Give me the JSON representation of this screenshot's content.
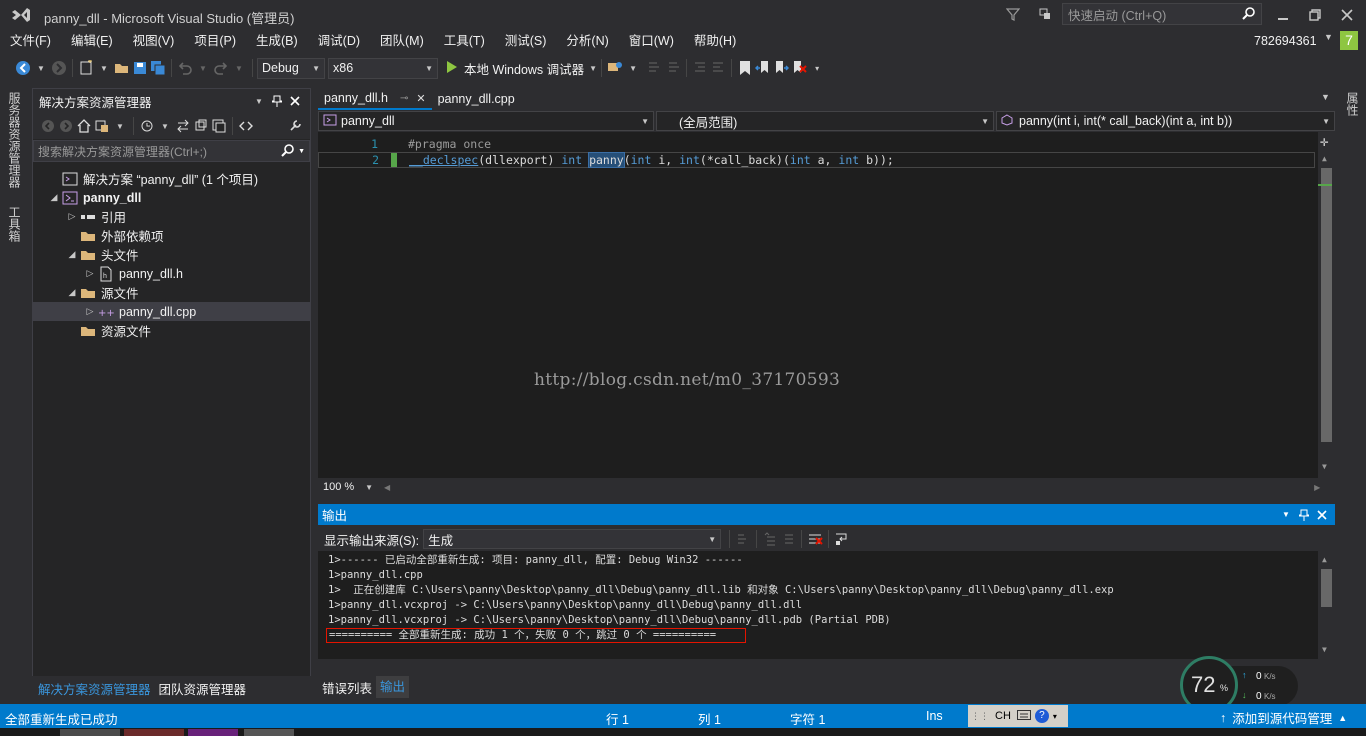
{
  "window": {
    "title": "panny_dll - Microsoft Visual Studio (管理员)",
    "quick_launch_placeholder": "快速启动 (Ctrl+Q)",
    "user": "782694361",
    "notif_count": "7"
  },
  "menu": [
    "文件(F)",
    "编辑(E)",
    "视图(V)",
    "项目(P)",
    "生成(B)",
    "调试(D)",
    "团队(M)",
    "工具(T)",
    "测试(S)",
    "分析(N)",
    "窗口(W)",
    "帮助(H)"
  ],
  "toolbar": {
    "config": "Debug",
    "platform": "x86",
    "run_label": "本地 Windows 调试器"
  },
  "left_strip": {
    "tab1": "服务器资源管理器",
    "tab2": "工具箱"
  },
  "right_strip": {
    "tab1": "属性"
  },
  "solution_explorer": {
    "title": "解决方案资源管理器",
    "search_placeholder": "搜索解决方案资源管理器(Ctrl+;)",
    "items": [
      {
        "label": "解决方案 “panny_dll” (1 个项目)",
        "indent": 0,
        "twisty": "",
        "icon": "solution-icon"
      },
      {
        "label": "panny_dll",
        "indent": 0,
        "twisty": "◢",
        "icon": "project-icon",
        "bold": true
      },
      {
        "label": "引用",
        "indent": 1,
        "twisty": "▷",
        "icon": "references-icon"
      },
      {
        "label": "外部依赖项",
        "indent": 1,
        "twisty": "",
        "icon": "folder-icon"
      },
      {
        "label": "头文件",
        "indent": 1,
        "twisty": "◢",
        "icon": "folder-icon"
      },
      {
        "label": "panny_dll.h",
        "indent": 2,
        "twisty": "▷",
        "icon": "header-file-icon"
      },
      {
        "label": "源文件",
        "indent": 1,
        "twisty": "◢",
        "icon": "folder-icon"
      },
      {
        "label": "panny_dll.cpp",
        "indent": 2,
        "twisty": "▷",
        "icon": "cpp-file-icon",
        "selected": true
      },
      {
        "label": "资源文件",
        "indent": 1,
        "twisty": "",
        "icon": "folder-icon"
      }
    ],
    "tabs": [
      "解决方案资源管理器",
      "团队资源管理器"
    ]
  },
  "editor": {
    "tabs": [
      "panny_dll.h",
      "panny_dll.cpp"
    ],
    "nav": {
      "project": "panny_dll",
      "scope": "(全局范围)",
      "member": "panny(int i, int(* call_back)(int a, int b))"
    },
    "line_numbers": [
      "1",
      "2"
    ],
    "line1": "#pragma once",
    "line2": {
      "a": "__declspec",
      "b": "(dllexport) ",
      "c": "int",
      "d": " ",
      "e": "panny",
      "f": "(",
      "g": "int",
      "h": " i, ",
      "i": "int",
      "j": "(*call_back)(",
      "k": "int",
      "l": " a, ",
      "m": "int",
      "n": " b));"
    },
    "watermark": "http://blog.csdn.net/m0_37170593",
    "zoom": "100 %"
  },
  "output": {
    "title": "输出",
    "source_label": "显示输出来源(S):",
    "source_value": "生成",
    "lines": [
      "1>------ 已启动全部重新生成: 项目: panny_dll, 配置: Debug Win32 ------",
      "1>panny_dll.cpp",
      "1>  正在创建库 C:\\Users\\panny\\Desktop\\panny_dll\\Debug\\panny_dll.lib 和对象 C:\\Users\\panny\\Desktop\\panny_dll\\Debug\\panny_dll.exp",
      "1>panny_dll.vcxproj -> C:\\Users\\panny\\Desktop\\panny_dll\\Debug\\panny_dll.dll",
      "1>panny_dll.vcxproj -> C:\\Users\\panny\\Desktop\\panny_dll\\Debug\\panny_dll.pdb (Partial PDB)"
    ],
    "result_line": "========== 全部重新生成: 成功 1 个，失败 0 个，跳过 0 个 ==========",
    "tabs": [
      "错误列表",
      "输出"
    ]
  },
  "status": {
    "message": "全部重新生成已成功",
    "row": "行 1",
    "col": "列 1",
    "char": "字符 1",
    "mode": "Ins",
    "ime": "CH",
    "source_control": "添加到源代码管理"
  },
  "net_widget": {
    "percent": "72",
    "unit": "%",
    "up": "0",
    "down": "0",
    "rate_unit": "K/s"
  },
  "colors": {
    "accent": "#007acc",
    "bg": "#2d2d30",
    "editor": "#1e1e1e",
    "vs_purple": "#68217a"
  }
}
